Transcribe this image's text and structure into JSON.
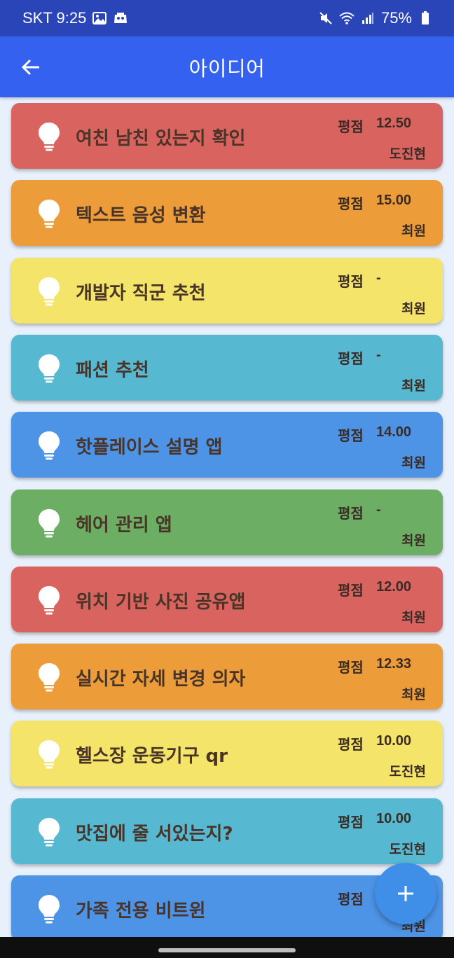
{
  "status_bar": {
    "carrier_time": "SKT 9:25",
    "battery": "75%",
    "icons": [
      "gallery-icon",
      "notification-icon",
      "mute-icon",
      "wifi-icon",
      "signal-icon",
      "battery-icon"
    ]
  },
  "app_bar": {
    "title": "아이디어",
    "back_icon": "arrow-left-icon"
  },
  "rating_label": "평점",
  "ideas": [
    {
      "title": "여친 남친 있는지 확인",
      "rating": "12.50",
      "author": "도진현",
      "color": "#d9635f"
    },
    {
      "title": "텍스트 음성 변환",
      "rating": "15.00",
      "author": "최원",
      "color": "#ec9d3a"
    },
    {
      "title": "개발자 직군 추천",
      "rating": "-",
      "author": "최원",
      "color": "#f4e56a"
    },
    {
      "title": "패션 추천",
      "rating": "-",
      "author": "최원",
      "color": "#57b8d1"
    },
    {
      "title": "핫플레이스 설명 앱",
      "rating": "14.00",
      "author": "최원",
      "color": "#4d93e6"
    },
    {
      "title": "헤어 관리 앱",
      "rating": "-",
      "author": "최원",
      "color": "#6bae64"
    },
    {
      "title": "위치 기반 사진 공유앱",
      "rating": "12.00",
      "author": "최원",
      "color": "#d9635f"
    },
    {
      "title": "실시간 자세 변경 의자",
      "rating": "12.33",
      "author": "최원",
      "color": "#ec9d3a"
    },
    {
      "title": "헬스장 운동기구 qr",
      "rating": "10.00",
      "author": "도진현",
      "color": "#f4e56a"
    },
    {
      "title": "맛집에 줄 서있는지?",
      "rating": "10.00",
      "author": "도진현",
      "color": "#57b8d1"
    },
    {
      "title": "가족 전용 비트윈",
      "rating": "",
      "author": "최원",
      "color": "#4d93e6"
    }
  ],
  "fab": {
    "icon": "plus-icon",
    "color": "#3f8ee8"
  }
}
